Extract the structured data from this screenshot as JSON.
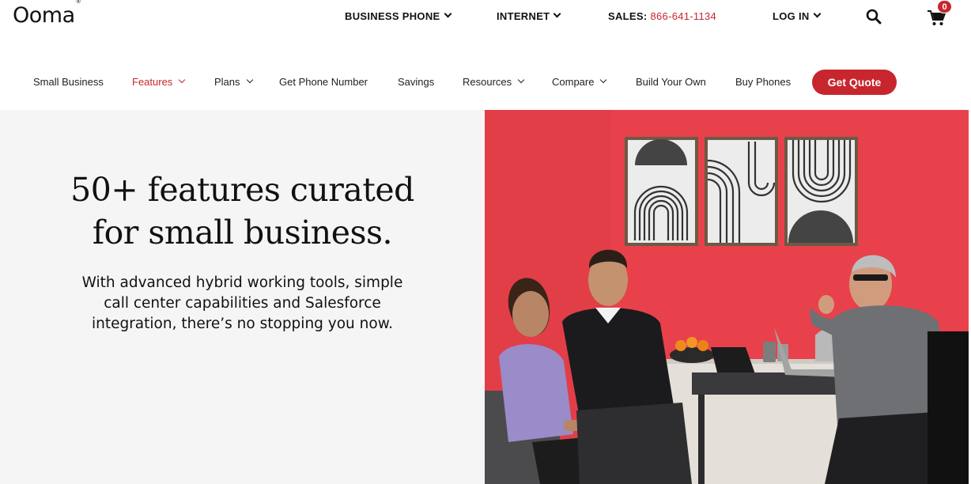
{
  "topbar": {
    "logo": "Ooma",
    "logo_mark": "®",
    "business_phone": "BUSINESS PHONE",
    "internet": "INTERNET",
    "sales_label": "SALES:",
    "sales_phone": "866-641-1134",
    "login": "LOG IN",
    "cart_count": "0",
    "icons": [
      "search-icon",
      "cart-icon"
    ]
  },
  "nav": {
    "items": [
      {
        "label": "Small Business"
      },
      {
        "label": "Features",
        "active": true
      },
      {
        "label": "Plans"
      },
      {
        "label": "Get Phone Number"
      },
      {
        "label": "Savings"
      },
      {
        "label": "Resources"
      },
      {
        "label": "Compare"
      },
      {
        "label": "Build Your Own"
      },
      {
        "label": "Buy Phones"
      }
    ],
    "cta": "Get Quote"
  },
  "hero": {
    "headline_line1": "50+ features curated",
    "headline_line2": "for small business.",
    "sub_line1": "With advanced hybrid working tools, simple",
    "sub_line2": "call center capabilities and Salesforce",
    "sub_line3": "integration, there’s no stopping you now."
  },
  "colors": {
    "brand_red": "#c8262e",
    "hero_bg": "#f5f5f5",
    "photo_wall": "#e8404a"
  }
}
